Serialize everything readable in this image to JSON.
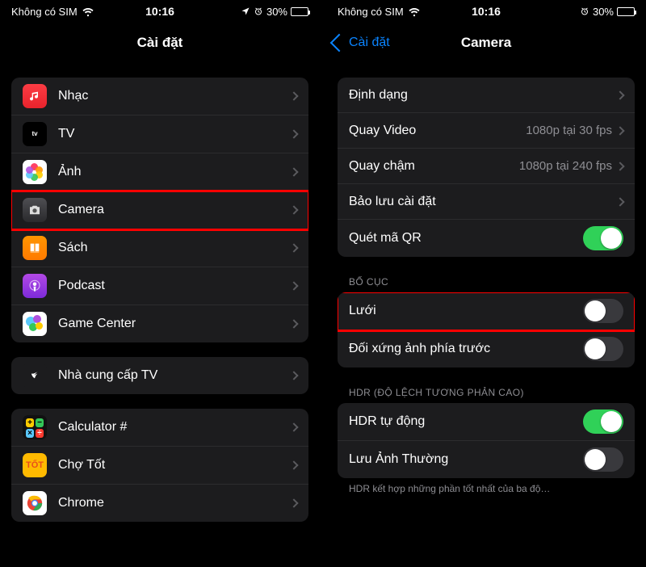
{
  "status": {
    "carrier": "Không có SIM",
    "time": "10:16",
    "battery_pct": "30%"
  },
  "left_pane": {
    "title": "Cài đặt",
    "group1": [
      {
        "label": "Nhạc"
      },
      {
        "label": "TV"
      },
      {
        "label": "Ảnh"
      },
      {
        "label": "Camera"
      },
      {
        "label": "Sách"
      },
      {
        "label": "Podcast"
      },
      {
        "label": "Game Center"
      }
    ],
    "group2": [
      {
        "label": "Nhà cung cấp TV"
      }
    ],
    "group3": [
      {
        "label": "Calculator #"
      },
      {
        "label": "Chợ Tốt"
      },
      {
        "label": "Chrome"
      }
    ]
  },
  "right_pane": {
    "back": "Cài đặt",
    "title": "Camera",
    "group1": [
      {
        "label": "Định dạng"
      },
      {
        "label": "Quay Video",
        "detail": "1080p tại 30 fps"
      },
      {
        "label": "Quay chậm",
        "detail": "1080p tại 240 fps"
      },
      {
        "label": "Bảo lưu cài đặt"
      },
      {
        "label": "Quét mã QR",
        "switch": true
      }
    ],
    "group2_header": "BỐ CỤC",
    "group2": [
      {
        "label": "Lưới",
        "switch": false
      },
      {
        "label": "Đối xứng ảnh phía trước",
        "switch": false
      }
    ],
    "group3_header": "HDR (ĐỘ LỆCH TƯƠNG PHẢN CAO)",
    "group3": [
      {
        "label": "HDR tự động",
        "switch": true
      },
      {
        "label": "Lưu Ảnh Thường",
        "switch": false
      }
    ],
    "footer": "HDR kết hợp những phần tốt nhất của ba độ…"
  }
}
